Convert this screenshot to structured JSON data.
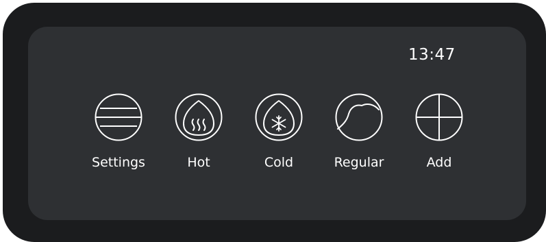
{
  "status": {
    "time": "13:47"
  },
  "menu": {
    "items": [
      {
        "label": "Settings",
        "icon": "settings-lines-icon"
      },
      {
        "label": "Hot",
        "icon": "hot-steam-icon"
      },
      {
        "label": "Cold",
        "icon": "cold-snowflake-icon"
      },
      {
        "label": "Regular",
        "icon": "regular-wave-icon"
      },
      {
        "label": "Add",
        "icon": "add-cross-icon"
      }
    ]
  },
  "colors": {
    "bezel": "#1b1c1e",
    "screen": "#2e3033",
    "foreground": "#ffffff"
  }
}
